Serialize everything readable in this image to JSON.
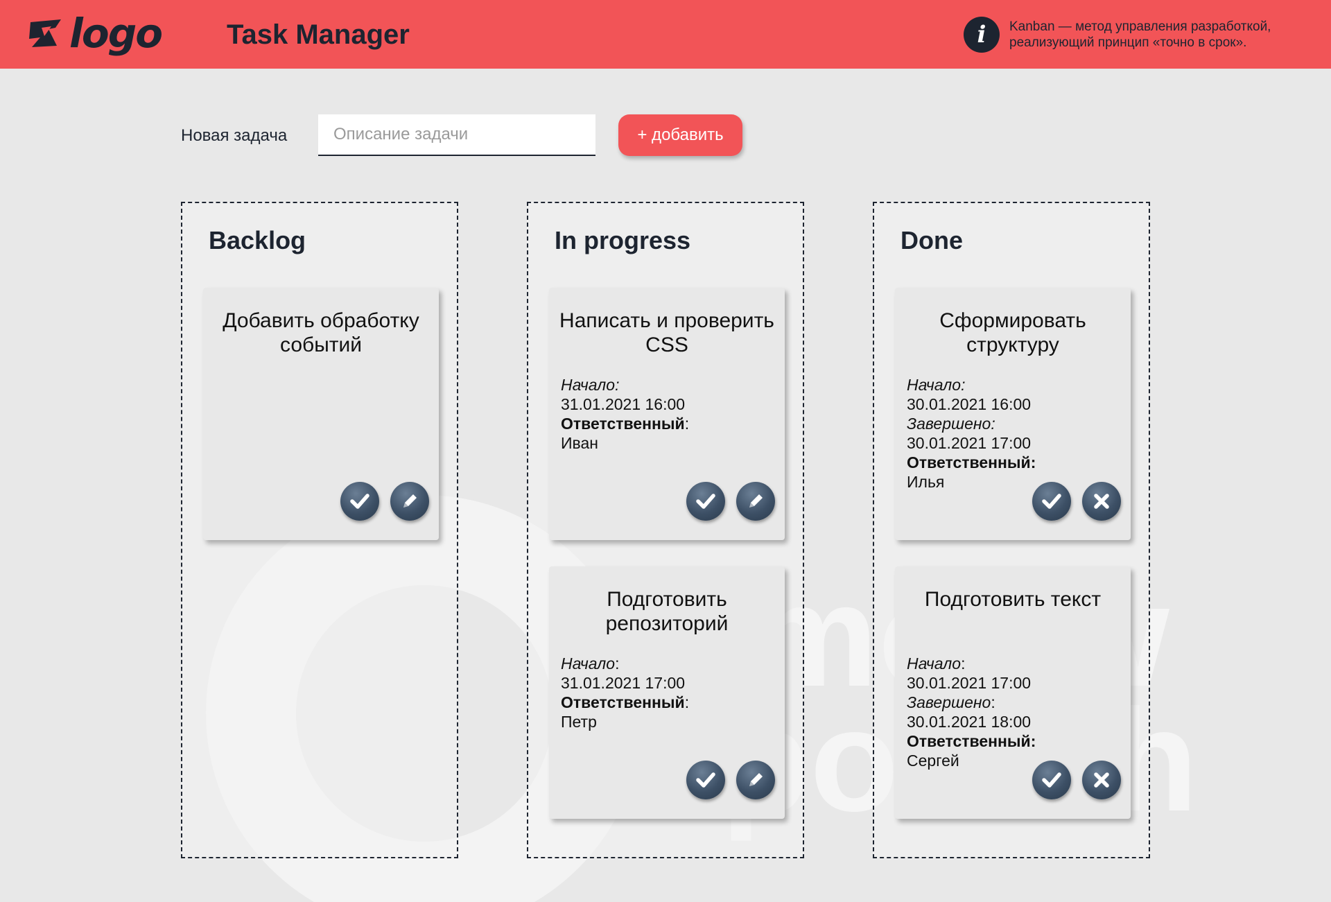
{
  "header": {
    "logo_text": "logo",
    "app_title": "Task Manager",
    "info_text": "Kanban — метод управления разработкой, реализующий принцип «точно в срок».",
    "info_icon": "i"
  },
  "new_task": {
    "label": "Новая задача",
    "placeholder": "Описание задачи",
    "value": "",
    "add_label": "+ добавить"
  },
  "columns": [
    {
      "title": "Backlog",
      "cards": [
        {
          "title": "Добавить обработку событий",
          "actions": [
            "check-icon",
            "pencil-icon"
          ]
        }
      ]
    },
    {
      "title": "In progress",
      "cards": [
        {
          "title": "Написать и проверить CSS",
          "start_label": "Начало:",
          "start": "31.01.2021 16:00",
          "assignee_label": "Ответственный",
          "assignee_colon": ":",
          "assignee": "Иван",
          "actions": [
            "check-icon",
            "pencil-icon"
          ]
        },
        {
          "title": "Подготовить репозиторий",
          "start_label": "Начало",
          "start_colon": ":",
          "start": "31.01.2021 17:00",
          "assignee_label": "Ответственный",
          "assignee_colon": ":",
          "assignee": "Петр",
          "actions": [
            "check-icon",
            "pencil-icon"
          ]
        }
      ]
    },
    {
      "title": "Done",
      "cards": [
        {
          "title": "Сформировать структуру",
          "start_label": "Начало:",
          "start": "30.01.2021 16:00",
          "finish_label": "Завершено:",
          "finish": "30.01.2021 17:00",
          "assignee_label": "Ответственный:",
          "assignee": "Илья",
          "actions": [
            "check-icon",
            "close-icon"
          ]
        },
        {
          "title": "Подготовить текст",
          "start_label": "Начало",
          "start_colon": ":",
          "start": "30.01.2021 17:00",
          "finish_label": "Завершено",
          "finish_colon": ":",
          "finish": "30.01.2021 18:00",
          "assignee_label": "Ответственный:",
          "assignee": "Сергей",
          "actions": [
            "check-icon",
            "close-icon"
          ]
        }
      ]
    }
  ],
  "watermark": {
    "line1": "moow",
    "line2": "potech"
  },
  "colors": {
    "header_bg": "#f25457",
    "page_bg": "#e8e8e8",
    "dark": "#1d2430",
    "accent_button": "#f25457",
    "action_button": "#3d5066"
  }
}
